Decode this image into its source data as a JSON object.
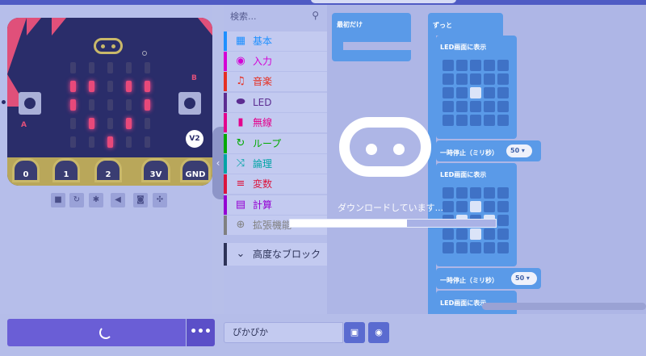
{
  "simulator": {
    "badge": "V2",
    "button_a": "A",
    "button_b": "B",
    "pins": [
      "0",
      "1",
      "2",
      "3V",
      "GND"
    ]
  },
  "toolbox": {
    "search_placeholder": "検索...",
    "categories": [
      {
        "label": "基本",
        "icon": "grid-icon",
        "color": "#1e90ff"
      },
      {
        "label": "入力",
        "icon": "circle-icon",
        "color": "#d400d4"
      },
      {
        "label": "音楽",
        "icon": "headphones-icon",
        "color": "#e63022"
      },
      {
        "label": "LED",
        "icon": "toggle-icon",
        "color": "#5c2d91"
      },
      {
        "label": "無線",
        "icon": "signal-bars-icon",
        "color": "#e3008c"
      },
      {
        "label": "ループ",
        "icon": "loop-arrow-icon",
        "color": "#00aa00"
      },
      {
        "label": "論理",
        "icon": "shuffle-icon",
        "color": "#00a4a6"
      },
      {
        "label": "変数",
        "icon": "list-icon",
        "color": "#dc143c"
      },
      {
        "label": "計算",
        "icon": "calculator-icon",
        "color": "#9400d3"
      },
      {
        "label": "拡張機能",
        "icon": "plus-circle-icon",
        "color": "#808080"
      },
      {
        "label": "高度なブロック",
        "icon": "chevron-down-icon",
        "color": "#2d3358"
      }
    ]
  },
  "workspace": {
    "on_start_label": "最初だけ",
    "forever_label": "ずっと",
    "show_leds_label": "LED画面に表示",
    "pause_label": "一時停止（ミリ秒）",
    "pause_value": "50",
    "led_pattern_1": [
      0,
      0,
      0,
      0,
      0,
      0,
      0,
      0,
      0,
      0,
      0,
      0,
      1,
      0,
      0,
      0,
      0,
      0,
      0,
      0,
      0,
      0,
      0,
      0,
      0
    ],
    "led_pattern_2": [
      0,
      0,
      0,
      0,
      0,
      0,
      0,
      1,
      0,
      0,
      0,
      1,
      0,
      1,
      0,
      0,
      0,
      1,
      0,
      0,
      0,
      0,
      0,
      0,
      0
    ]
  },
  "overlay": {
    "status": "ダウンロードしています...",
    "progress": 0.57
  },
  "bottom": {
    "project_name": "ぴかぴか",
    "more_label": "•••"
  }
}
